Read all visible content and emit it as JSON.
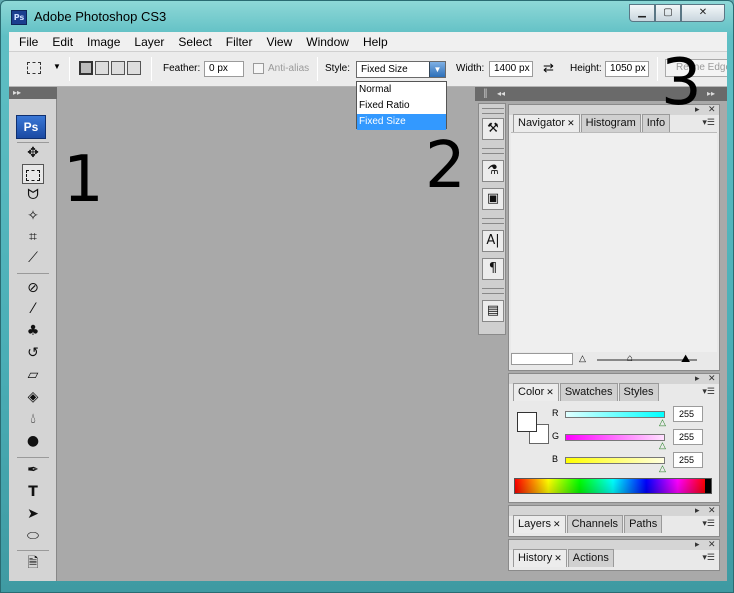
{
  "window": {
    "title": "Adobe Photoshop CS3",
    "app_badge": "Ps",
    "controls": [
      "minimize-icon",
      "maximize-icon",
      "close-icon"
    ]
  },
  "menubar": {
    "items": [
      "File",
      "Edit",
      "Image",
      "Layer",
      "Select",
      "Filter",
      "View",
      "Window",
      "Help"
    ]
  },
  "options": {
    "feather_label": "Feather:",
    "feather_value": "0 px",
    "antialias_label": "Anti-alias",
    "style_label": "Style:",
    "style_value": "Fixed Size",
    "style_options": [
      "Normal",
      "Fixed Ratio",
      "Fixed Size"
    ],
    "width_label": "Width:",
    "width_value": "1400 px",
    "height_label": "Height:",
    "height_value": "1050 px",
    "refine_edge": "Refine Edge..."
  },
  "toolbox": {
    "logo": "Ps",
    "tools": [
      "move-tool-icon",
      "marquee-tool-icon",
      "lasso-tool-icon",
      "magic-wand-icon",
      "crop-tool-icon",
      "eyedropper-icon",
      "healing-brush-icon",
      "brush-tool-icon",
      "clone-stamp-icon",
      "history-brush-icon",
      "eraser-icon",
      "paint-bucket-icon",
      "blur-tool-icon",
      "dodge-tool-icon",
      "pen-tool-icon",
      "type-tool-icon",
      "path-selection-icon",
      "ellipse-tool-icon",
      "notes-tool-icon"
    ],
    "active_tool": "marquee-tool-icon"
  },
  "annotations": [
    "1",
    "2",
    "3"
  ],
  "panels": {
    "navigator": {
      "tabs": [
        "Navigator",
        "Histogram",
        "Info"
      ],
      "active": "Navigator"
    },
    "color": {
      "tabs": [
        "Color",
        "Swatches",
        "Styles"
      ],
      "active": "Color",
      "channels": [
        {
          "label": "R",
          "value": "255",
          "color": "#00ffff"
        },
        {
          "label": "G",
          "value": "255",
          "color": "#ff00ff"
        },
        {
          "label": "B",
          "value": "255",
          "color": "#ffff00"
        }
      ]
    },
    "layers": {
      "tabs": [
        "Layers",
        "Channels",
        "Paths"
      ],
      "active": "Layers"
    },
    "history": {
      "tabs": [
        "History",
        "Actions"
      ],
      "active": "History"
    }
  },
  "colors": {
    "selection_highlight": "#3399ff",
    "workspace_gray": "#a9a9a9"
  }
}
